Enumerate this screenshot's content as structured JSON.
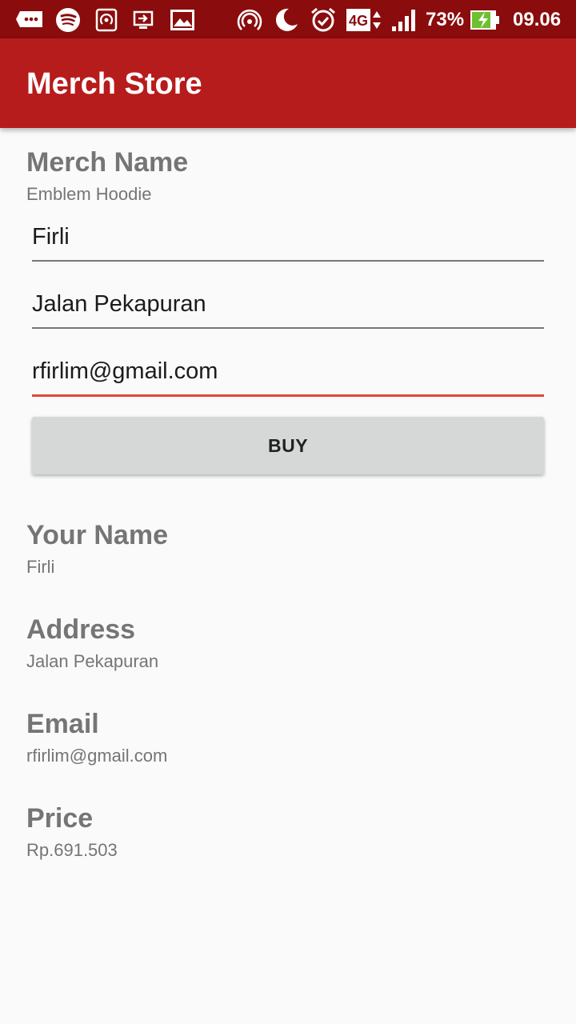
{
  "status_bar": {
    "icons_left": [
      "notification-icon",
      "spotify-icon",
      "hotspot-icon",
      "screen-cast-icon",
      "gallery-icon"
    ],
    "icons_right": [
      "wireless-icon",
      "moon-icon",
      "alarm-icon"
    ],
    "network": "4G",
    "battery_percent": "73%",
    "time": "09.06"
  },
  "app_bar": {
    "title": "Merch Store",
    "color": "#b71c1c"
  },
  "merch": {
    "label": "Merch Name",
    "value": "Emblem Hoodie"
  },
  "form": {
    "name_value": "Firli",
    "address_value": "Jalan Pekapuran",
    "email_value": "rfirlim@gmail.com",
    "buy_label": "BUY",
    "accent_color": "#e2463f"
  },
  "summary": {
    "name_label": "Your Name",
    "name_value": "Firli",
    "address_label": "Address",
    "address_value": "Jalan Pekapuran",
    "email_label": "Email",
    "email_value": "rfirlim@gmail.com",
    "price_label": "Price",
    "price_value": "Rp.691.503"
  }
}
